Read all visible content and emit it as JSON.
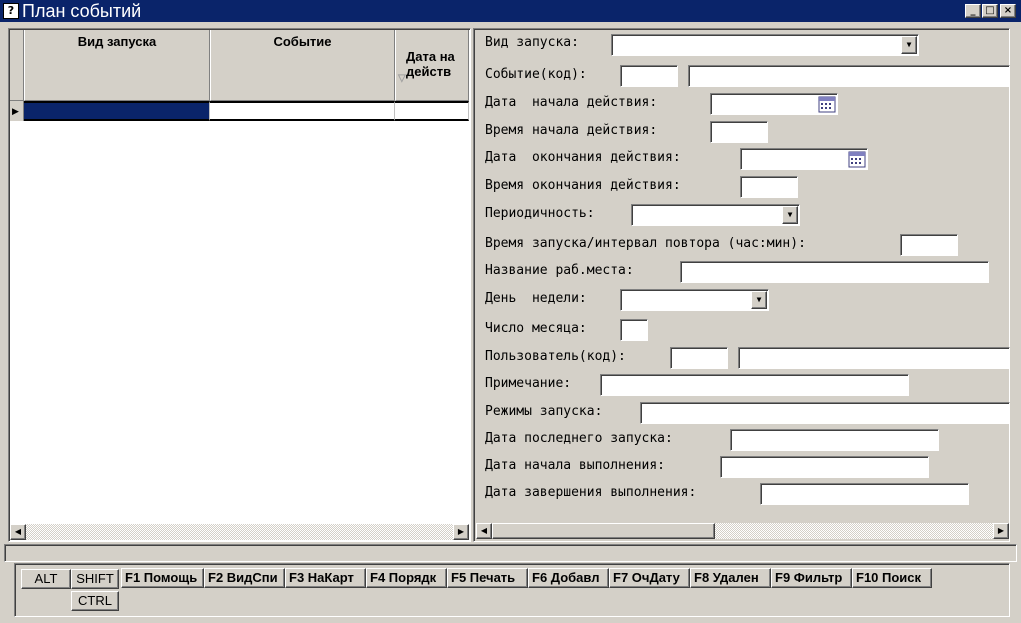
{
  "window": {
    "title": "План событий",
    "app_icon": "?",
    "minimize": "_",
    "maximize": "□",
    "close": "×"
  },
  "grid": {
    "columns": [
      {
        "label": "Вид запуска"
      },
      {
        "label": "Событие"
      },
      {
        "label": "Дата на\nдейств"
      }
    ],
    "sort_mark": "▽",
    "row_indicator": "▶"
  },
  "form": {
    "launch_type": {
      "label": "Вид запуска:",
      "value": ""
    },
    "event": {
      "label": "Событие(код):",
      "code": "",
      "name": ""
    },
    "start_date": {
      "label": "Дата  начала действия:",
      "value": "  .  ."
    },
    "start_time": {
      "label": "Время начала действия:",
      "value": ""
    },
    "end_date": {
      "label": "Дата  окончания действия:",
      "value": "  .  ."
    },
    "end_time": {
      "label": "Время окончания действия:",
      "value": ""
    },
    "periodicity": {
      "label": "Периодичность:",
      "value": ""
    },
    "launch_interval": {
      "label": "Время запуска/интервал повтора (час:мин):",
      "value": ""
    },
    "workplace": {
      "label": "Название раб.места:",
      "value": ""
    },
    "weekday": {
      "label": "День  недели:",
      "value": ""
    },
    "month_day": {
      "label": "Число месяца:",
      "value": ""
    },
    "user": {
      "label": "Пользователь(код):",
      "code": "",
      "name": ""
    },
    "note": {
      "label": "Примечание:",
      "value": ""
    },
    "modes": {
      "label": "Режимы запуска:",
      "value": ""
    },
    "last_launch": {
      "label": "Дата последнего запуска:",
      "value": ""
    },
    "exec_start": {
      "label": "Дата начала выполнения:",
      "value": ""
    },
    "exec_end": {
      "label": "Дата завершения выполнения:",
      "value": ""
    }
  },
  "keys": {
    "alt": "ALT",
    "shift": "SHIFT",
    "ctrl": "CTRL",
    "f1": "F1 Помощь",
    "f2": "F2 ВидСпи",
    "f3": "F3 НаКарт",
    "f4": "F4 Порядк",
    "f5": "F5 Печать",
    "f6": "F6 Добавл",
    "f7": "F7 ОчДату",
    "f8": "F8 Удален",
    "f9": "F9 Фильтр",
    "f10": "F10 Поиск"
  },
  "icons": {
    "dropdown": "▼",
    "scroll_left": "◀",
    "scroll_right": "▶"
  }
}
